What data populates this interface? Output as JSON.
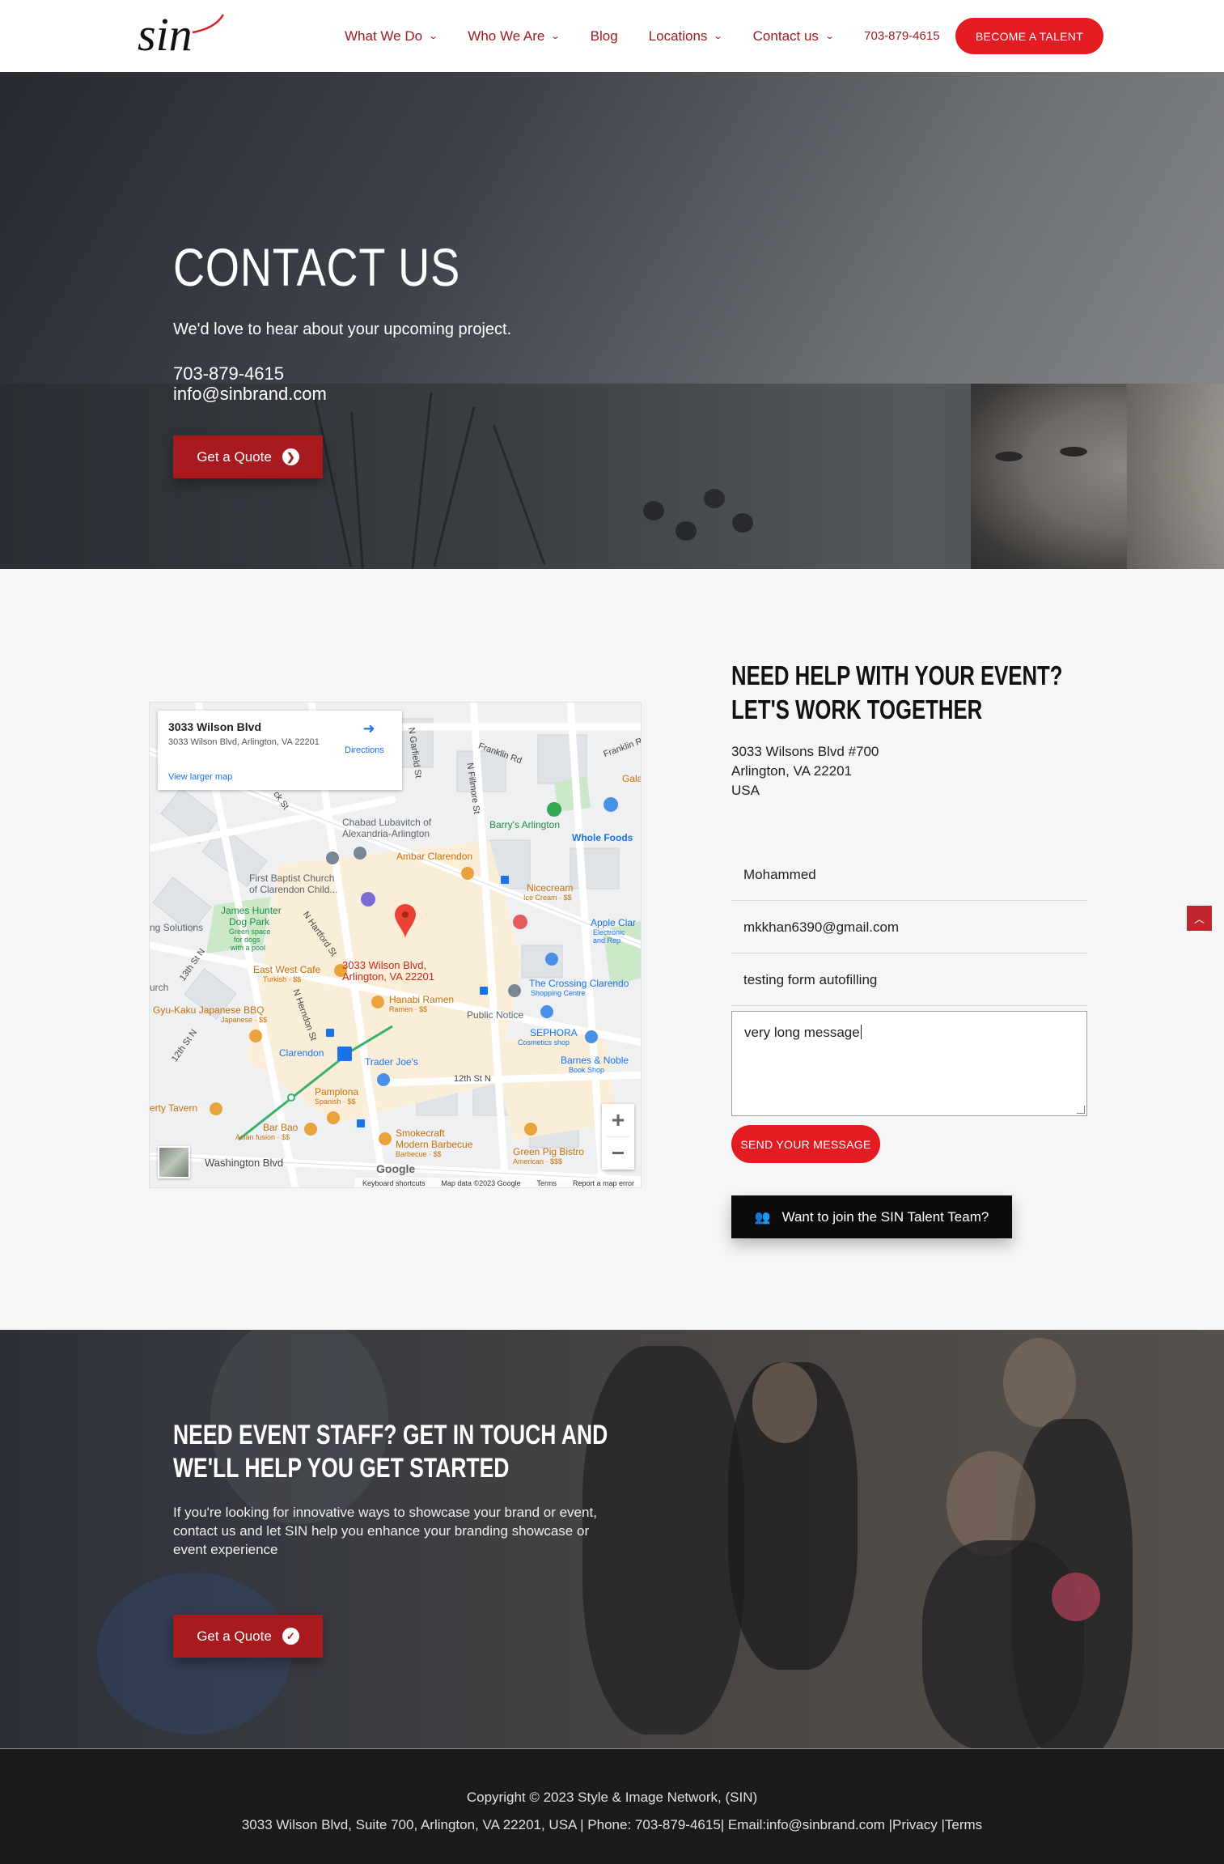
{
  "header": {
    "logo_text": "sin",
    "nav": [
      {
        "label": "What We Do",
        "dropdown": true
      },
      {
        "label": "Who We Are",
        "dropdown": true
      },
      {
        "label": "Blog",
        "dropdown": false
      },
      {
        "label": "Locations",
        "dropdown": true
      },
      {
        "label": "Contact us",
        "dropdown": true
      }
    ],
    "phone": "703-879-4615",
    "cta_label": "BECOME A TALENT"
  },
  "hero": {
    "title": "CONTACT US",
    "subtitle": "We'd love to hear about your upcoming project.",
    "phone": "703-879-4615",
    "email": "info@sinbrand.com",
    "quote_label": "Get a Quote"
  },
  "map": {
    "place_title": "3033 Wilson Blvd",
    "place_address": "3033 Wilson Blvd, Arlington, VA 22201",
    "directions_label": "Directions",
    "larger_map_label": "View larger map",
    "pin_label_line1": "3033 Wilson Blvd,",
    "pin_label_line2": "Arlington, VA 22201",
    "labels": [
      {
        "text": "Chabad Lubavitch of",
        "color": "#5f6368"
      },
      {
        "text": "Alexandria-Arlington",
        "color": "#5f6368"
      },
      {
        "text": "Barry's Arlington",
        "color": "#1e8e3e"
      },
      {
        "text": "Whole Foods",
        "color": "#1a73e8"
      },
      {
        "text": "Ambar Clarendon",
        "color": "#c5700b"
      },
      {
        "text": "First Baptist Church",
        "color": "#5f6368"
      },
      {
        "text": "of Clarendon Child...",
        "color": "#5f6368"
      },
      {
        "text": "Nicecream",
        "color": "#c5700b"
      },
      {
        "text": "Ice Cream · $$",
        "color": "#c5700b"
      },
      {
        "text": "James Hunter",
        "color": "#1e8e3e"
      },
      {
        "text": "Dog Park",
        "color": "#1e8e3e"
      },
      {
        "text": "Green space",
        "color": "#1e8e3e"
      },
      {
        "text": "for dogs",
        "color": "#1e8e3e"
      },
      {
        "text": "with a pool",
        "color": "#1e8e3e"
      },
      {
        "text": "Apple Clar",
        "color": "#1a73e8"
      },
      {
        "text": "Electronic",
        "color": "#1a73e8"
      },
      {
        "text": "and Rep",
        "color": "#1a73e8"
      },
      {
        "text": "East West Cafe",
        "color": "#c5700b"
      },
      {
        "text": "Turkish · $$",
        "color": "#c5700b"
      },
      {
        "text": "The Crossing Clarendo",
        "color": "#1a73e8"
      },
      {
        "text": "Shopping Centre",
        "color": "#1a73e8"
      },
      {
        "text": "Hanabi Ramen",
        "color": "#c5700b"
      },
      {
        "text": "Ramen · $$",
        "color": "#c5700b"
      },
      {
        "text": "Public Notice",
        "color": "#5f6368"
      },
      {
        "text": "Gyu-Kaku Japanese BBQ",
        "color": "#c5700b"
      },
      {
        "text": "Japanese · $$",
        "color": "#c5700b"
      },
      {
        "text": "SEPHORA",
        "color": "#1a73e8"
      },
      {
        "text": "Cosmetics shop",
        "color": "#1a73e8"
      },
      {
        "text": "Clarendon",
        "color": "#1a73e8"
      },
      {
        "text": "Barnes & Noble",
        "color": "#1a73e8"
      },
      {
        "text": "Book Shop",
        "color": "#1a73e8"
      },
      {
        "text": "Trader Joe's",
        "color": "#1a73e8"
      },
      {
        "text": "12th St N",
        "color": "#444"
      },
      {
        "text": "erty Tavern",
        "color": "#c5700b"
      },
      {
        "text": "Pamplona",
        "color": "#c5700b"
      },
      {
        "text": "Spanish · $$",
        "color": "#c5700b"
      },
      {
        "text": "Bar Bao",
        "color": "#c5700b"
      },
      {
        "text": "Asian fusion · $$",
        "color": "#c5700b"
      },
      {
        "text": "Smokecraft",
        "color": "#c5700b"
      },
      {
        "text": "Modern Barbecue",
        "color": "#c5700b"
      },
      {
        "text": "Barbecue · $$",
        "color": "#c5700b"
      },
      {
        "text": "Green Pig Bistro",
        "color": "#c5700b"
      },
      {
        "text": "American · $$$",
        "color": "#c5700b"
      },
      {
        "text": "Washington Blvd",
        "color": "#444"
      },
      {
        "text": "Franklin Rd",
        "color": "#444"
      },
      {
        "text": "Franklin R",
        "color": "#444"
      },
      {
        "text": "Gala",
        "color": "#c5700b"
      },
      {
        "text": "ng Solutions",
        "color": "#5f6368"
      },
      {
        "text": "urch",
        "color": "#5f6368"
      },
      {
        "text": "13th St N",
        "color": "#444"
      },
      {
        "text": "12th St N",
        "color": "#444"
      },
      {
        "text": "N Hartford St",
        "color": "#444"
      },
      {
        "text": "N Herndon St",
        "color": "#444"
      },
      {
        "text": "N Fillmore St",
        "color": "#444"
      },
      {
        "text": "N Garfield St",
        "color": "#444"
      },
      {
        "text": "ck St",
        "color": "#444"
      }
    ],
    "google_label": "Google",
    "footer_links": [
      "Keyboard shortcuts",
      "Map data ©2023 Google",
      "Terms",
      "Report a map error"
    ],
    "zoom_in": "+",
    "zoom_out": "−"
  },
  "contact": {
    "title": "NEED HELP WITH YOUR EVENT? LET'S WORK TOGETHER",
    "address_line1": "3033 Wilsons Blvd #700",
    "address_line2": "Arlington, VA 22201",
    "address_line3": "USA",
    "name_value": "Mohammed",
    "email_value": "mkkhan6390@gmail.com",
    "subject_value": "testing form autofilling",
    "message_value": "very long message",
    "send_label": "SEND YOUR MESSAGE",
    "join_label": "Want to join the SIN Talent Team?"
  },
  "cta": {
    "title": "NEED EVENT STAFF? GET IN TOUCH AND WE'LL HELP YOU GET STARTED",
    "text": "If you're looking for innovative ways to showcase your brand or event, contact us and let SIN help you enhance your branding showcase or event experience",
    "quote_label": "Get a Quote"
  },
  "footer": {
    "copyright": "Copyright © 2023 Style & Image Network, (SIN)",
    "line": "3033 Wilson Blvd, Suite 700, Arlington, VA 22201, USA | Phone: 703-879-4615| Email:info@sinbrand.com |Privacy |Terms"
  },
  "colors": {
    "brand_red": "#e31b23",
    "dark_red": "#a71b1f",
    "nav_red": "#9a1c22"
  }
}
